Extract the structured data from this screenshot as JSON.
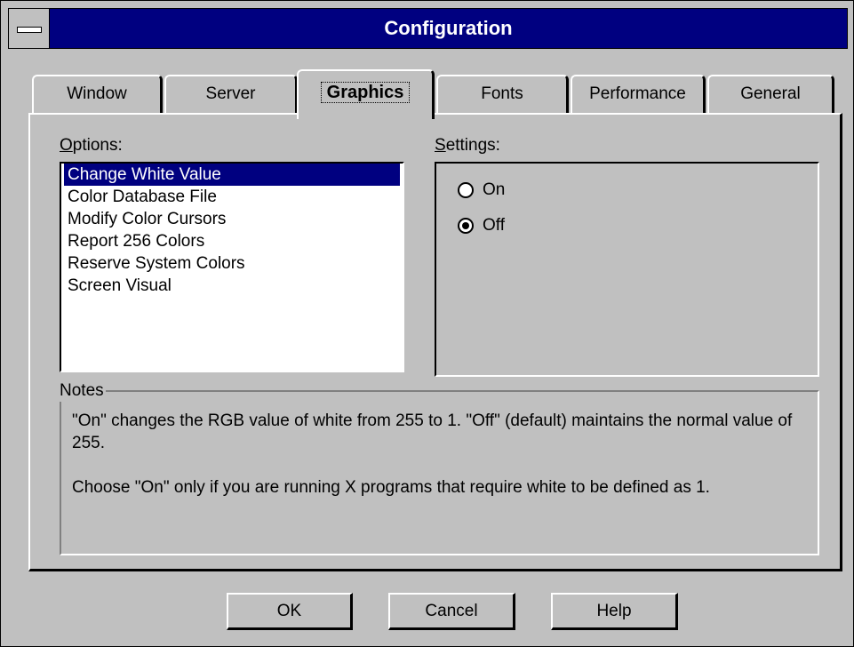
{
  "window": {
    "title": "Configuration"
  },
  "tabs": [
    {
      "label": "Window",
      "active": false
    },
    {
      "label": "Server",
      "active": false
    },
    {
      "label": "Graphics",
      "active": true
    },
    {
      "label": "Fonts",
      "active": false
    },
    {
      "label": "Performance",
      "active": false
    },
    {
      "label": "General",
      "active": false
    }
  ],
  "options": {
    "label_mnemonic": "O",
    "label_rest": "ptions:",
    "items": [
      "Change White Value",
      "Color Database File",
      "Modify Color Cursors",
      "Report 256 Colors",
      "Reserve System Colors",
      "Screen Visual"
    ],
    "selected": "Change White Value"
  },
  "settings": {
    "label_mnemonic": "S",
    "label_rest": "ettings:",
    "radios": [
      {
        "label": "On",
        "checked": false
      },
      {
        "label": "Off",
        "checked": true
      }
    ]
  },
  "notes": {
    "legend": "Notes",
    "paragraph1": "\"On\" changes the RGB value of white from 255 to 1. \"Off\" (default) maintains the normal value of 255.",
    "paragraph2": "Choose \"On\" only if you are running X programs that require white to be defined as 1."
  },
  "buttons": {
    "ok": "OK",
    "cancel": "Cancel",
    "help": "Help"
  },
  "colors": {
    "titlebar": "#000080",
    "face": "#c0c0c0",
    "selection": "#000080"
  }
}
